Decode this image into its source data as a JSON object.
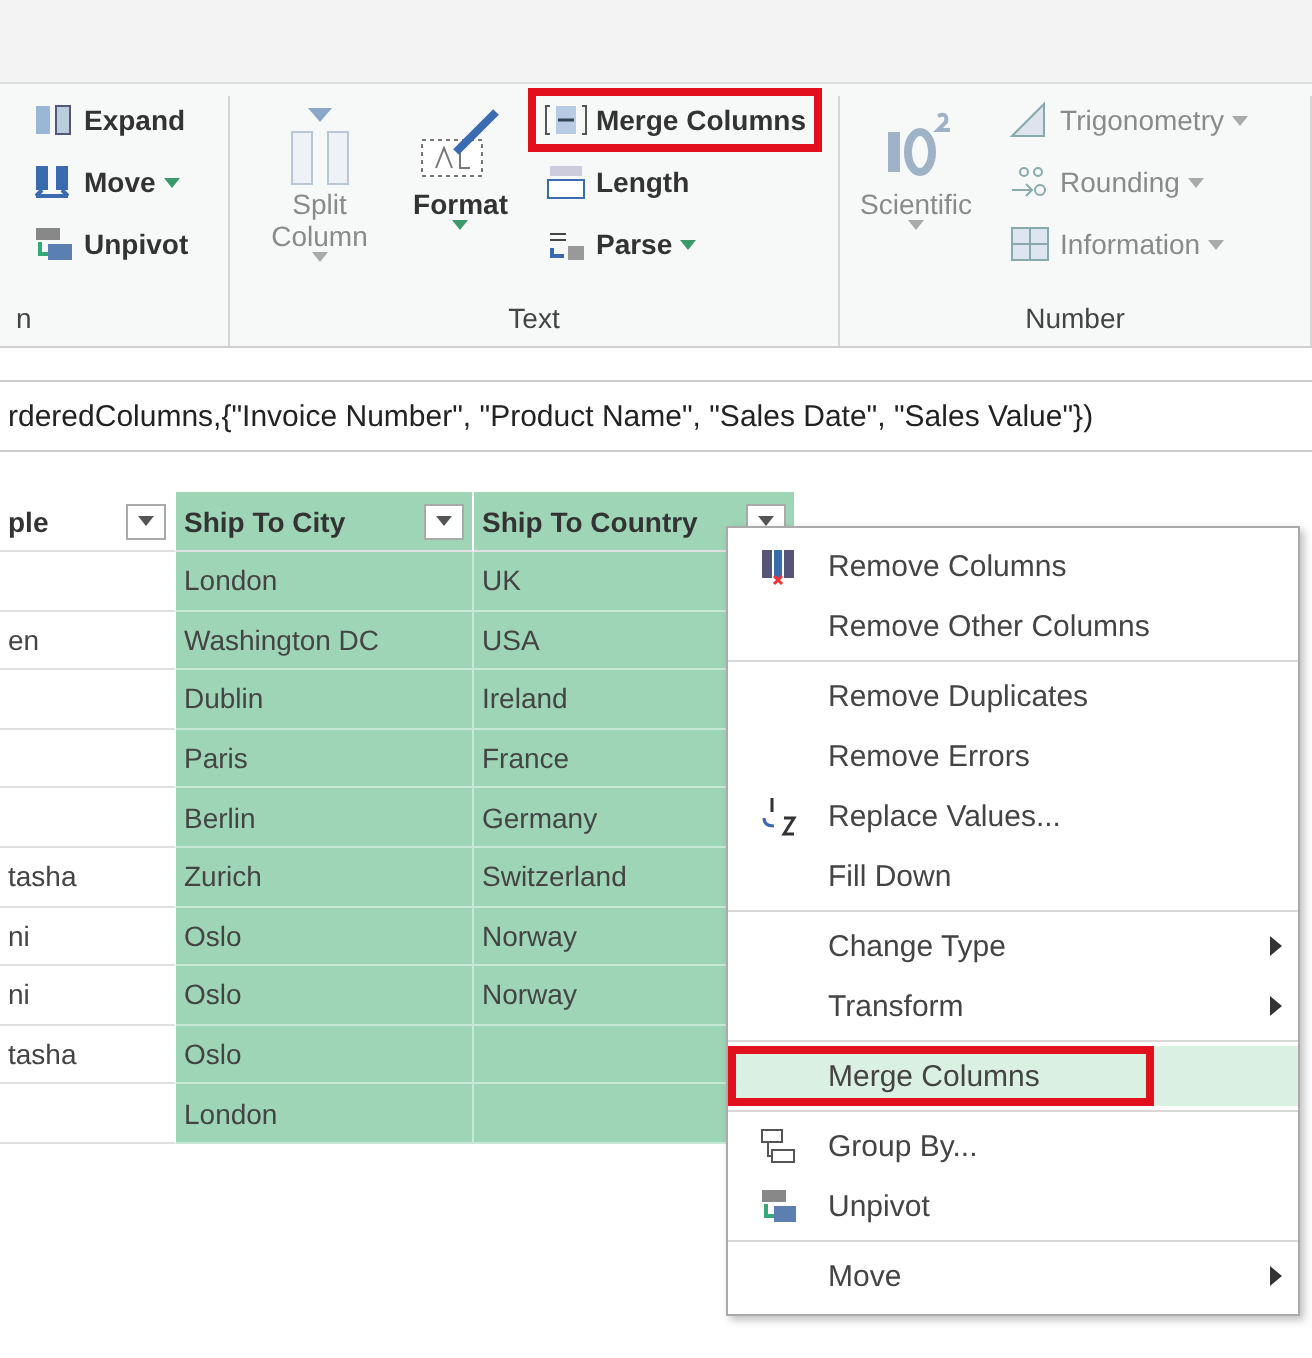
{
  "ribbon": {
    "groups": [
      {
        "label": "n",
        "small": [
          {
            "label": "Expand",
            "kind": "expand",
            "dropdown": false,
            "disabled": false,
            "highlighted": false
          },
          {
            "label": "Move",
            "kind": "move",
            "dropdown": true,
            "disabled": false,
            "highlighted": false
          },
          {
            "label": "Unpivot",
            "kind": "unpivot",
            "dropdown": false,
            "disabled": false,
            "highlighted": false
          }
        ]
      },
      {
        "label": "Text",
        "large": [
          {
            "label": "Split Column",
            "kind": "split",
            "dropdown": true,
            "disabled": true
          },
          {
            "label": "Format",
            "kind": "format",
            "dropdown": true,
            "disabled": false
          }
        ],
        "small": [
          {
            "label": "Merge Columns",
            "kind": "merge",
            "dropdown": false,
            "disabled": false,
            "highlighted": true
          },
          {
            "label": "Length",
            "kind": "length",
            "dropdown": false,
            "disabled": false,
            "highlighted": false
          },
          {
            "label": "Parse",
            "kind": "parse",
            "dropdown": true,
            "disabled": false,
            "highlighted": false
          }
        ]
      },
      {
        "label": "Number",
        "large": [
          {
            "label": "Scientific",
            "kind": "scientific",
            "dropdown": true,
            "disabled": true
          }
        ],
        "small": [
          {
            "label": "Trigonometry",
            "kind": "trig",
            "dropdown": true,
            "disabled": true,
            "highlighted": false
          },
          {
            "label": "Rounding",
            "kind": "rounding",
            "dropdown": true,
            "disabled": true,
            "highlighted": false
          },
          {
            "label": "Information",
            "kind": "info",
            "dropdown": true,
            "disabled": true,
            "highlighted": false
          }
        ]
      }
    ]
  },
  "formula": "rderedColumns,{\"Invoice Number\", \"Product Name\", \"Sales Date\", \"Sales Value\"})",
  "table": {
    "columns": [
      {
        "name": "ple",
        "selected": false
      },
      {
        "name": "Ship To City",
        "selected": true
      },
      {
        "name": "Ship To Country",
        "selected": true
      }
    ],
    "rows": [
      [
        "",
        "London",
        "UK"
      ],
      [
        "en",
        "Washington DC",
        "USA"
      ],
      [
        "",
        "Dublin",
        "Ireland"
      ],
      [
        "",
        "Paris",
        "France"
      ],
      [
        "",
        "Berlin",
        "Germany"
      ],
      [
        "tasha",
        "Zurich",
        "Switzerland"
      ],
      [
        "ni",
        "Oslo",
        "Norway"
      ],
      [
        "ni",
        "Oslo",
        "Norway"
      ],
      [
        "tasha",
        "Oslo",
        ""
      ],
      [
        "",
        "London",
        ""
      ]
    ]
  },
  "menu": {
    "groups": [
      [
        {
          "label": "Remove Columns",
          "kind": "remove",
          "submenu": false,
          "selected": false,
          "highlighted": false
        },
        {
          "label": "Remove Other Columns",
          "kind": "plain",
          "submenu": false,
          "selected": false,
          "highlighted": false
        }
      ],
      [
        {
          "label": "Remove Duplicates",
          "kind": "plain",
          "submenu": false,
          "selected": false,
          "highlighted": false
        },
        {
          "label": "Remove Errors",
          "kind": "plain",
          "submenu": false,
          "selected": false,
          "highlighted": false
        },
        {
          "label": "Replace Values...",
          "kind": "replace",
          "submenu": false,
          "selected": false,
          "highlighted": false
        },
        {
          "label": "Fill Down",
          "kind": "plain",
          "submenu": false,
          "selected": false,
          "highlighted": false
        }
      ],
      [
        {
          "label": "Change Type",
          "kind": "plain",
          "submenu": true,
          "selected": false,
          "highlighted": false
        },
        {
          "label": "Transform",
          "kind": "plain",
          "submenu": true,
          "selected": false,
          "highlighted": false
        }
      ],
      [
        {
          "label": "Merge Columns",
          "kind": "plain",
          "submenu": false,
          "selected": true,
          "highlighted": true
        }
      ],
      [
        {
          "label": "Group By...",
          "kind": "group",
          "submenu": false,
          "selected": false,
          "highlighted": false
        },
        {
          "label": "Unpivot",
          "kind": "unpivot",
          "submenu": false,
          "selected": false,
          "highlighted": false
        }
      ],
      [
        {
          "label": "Move",
          "kind": "plain",
          "submenu": true,
          "selected": false,
          "highlighted": false
        }
      ]
    ]
  }
}
